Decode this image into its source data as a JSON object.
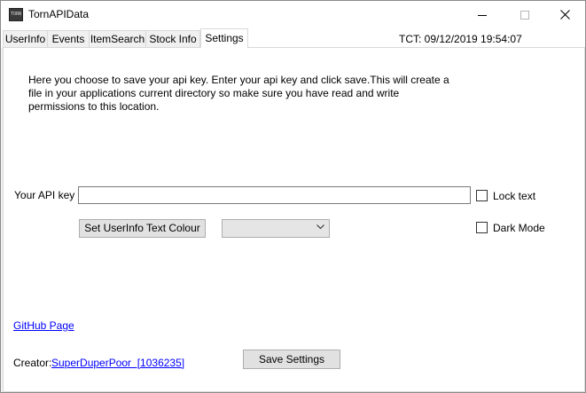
{
  "window": {
    "title": "TornAPIData",
    "icon_text": "TORN",
    "controls": {
      "minimize": "minimize-icon",
      "maximize": "maximize-icon",
      "close": "close-icon"
    }
  },
  "tabs": [
    {
      "label": "UserInfo",
      "active": false
    },
    {
      "label": "Events",
      "active": false
    },
    {
      "label": "ItemSearch",
      "active": false
    },
    {
      "label": "Stock Info",
      "active": false
    },
    {
      "label": "Settings",
      "active": true
    }
  ],
  "tct": "TCT: 09/12/2019 19:54:07",
  "settings": {
    "info_text": "Here you choose to save your api key. Enter your api key and click save.This will create a file in your applications current directory so make sure you have read and write permissions to this location.",
    "api_key_label": "Your API key",
    "api_key_value": "",
    "lock_text_label": "Lock text",
    "lock_text_checked": false,
    "dark_mode_label": "Dark Mode",
    "dark_mode_checked": false,
    "set_colour_button": "Set UserInfo Text Colour",
    "colour_select_value": "",
    "github_link": "GitHub Page",
    "creator_label": "Creator:",
    "creator_link": "SuperDuperPoor  [1036235]",
    "save_button": "Save Settings"
  },
  "colors": {
    "link": "#0000ff",
    "panel": "#ffffff",
    "window": "#f0f0f0",
    "button": "#e1e1e1"
  }
}
